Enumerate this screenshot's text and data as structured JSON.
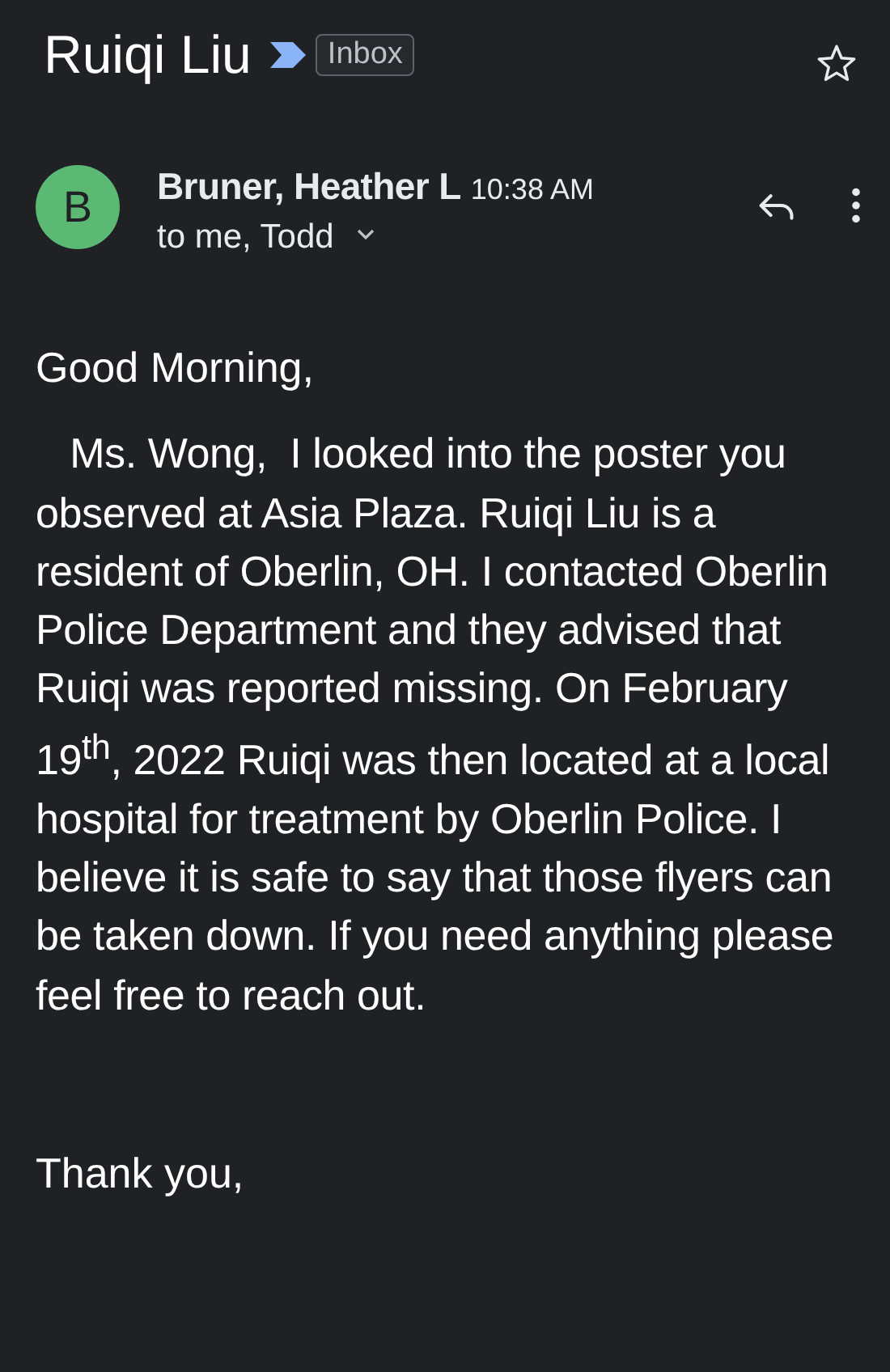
{
  "subject": {
    "title": "Ruiqi Liu",
    "important": true,
    "label": "Inbox",
    "starred": false
  },
  "message": {
    "avatar_letter": "B",
    "sender": "Bruner, Heather L",
    "time": "10:38 AM",
    "recipients": "to me, Todd"
  },
  "body": {
    "greeting": "Good Morning,",
    "paragraph": "   Ms. Wong,  I looked into the poster you observed at Asia Plaza. Ruiqi Liu is a resident of Oberlin, OH. I contacted Oberlin Police Department and they advised that Ruiqi was reported missing. On February 19$^{th}$, 2022 Ruiqi was then located at a local hospital for treatment by Oberlin Police. I believe it is safe to say that those flyers can be taken down. If you need anything please feel free to reach out.",
    "closing": "Thank you,"
  }
}
